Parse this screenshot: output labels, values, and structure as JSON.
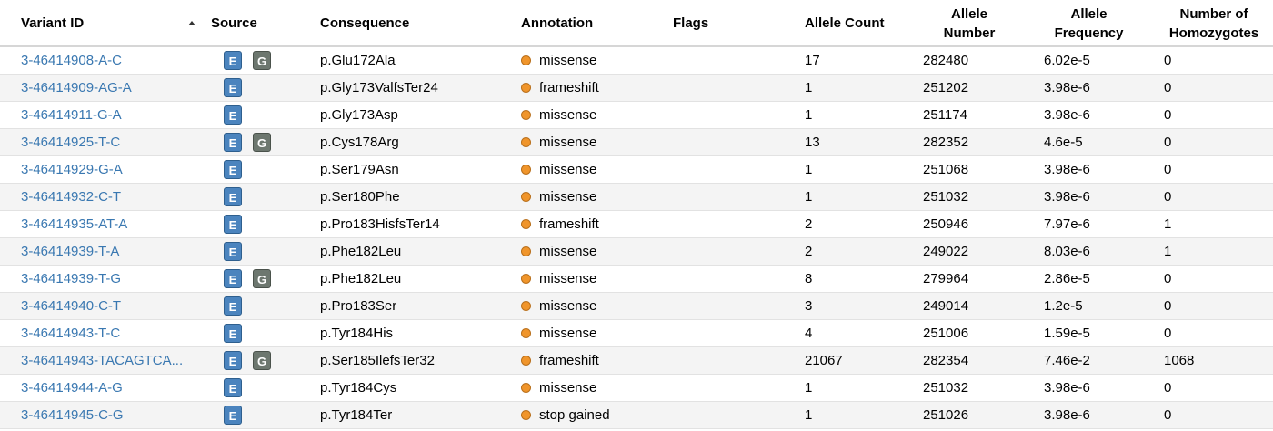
{
  "headers": {
    "variant_id": "Variant ID",
    "source": "Source",
    "consequence": "Consequence",
    "annotation": "Annotation",
    "flags": "Flags",
    "allele_count": "Allele Count",
    "allele_number_1": "Allele",
    "allele_number_2": "Number",
    "allele_frequency_1": "Allele",
    "allele_frequency_2": "Frequency",
    "homozygotes_1": "Number of",
    "homozygotes_2": "Homozygotes"
  },
  "badges": {
    "exome": "E",
    "genome": "G"
  },
  "colors": {
    "link": "#3a78b1",
    "exome_badge": "#4b84be",
    "genome_badge": "#6d776f",
    "annotation_dot": "#f0952b"
  },
  "rows": [
    {
      "variant_id": "3-46414908-A-C",
      "exome": true,
      "genome": true,
      "consequence": "p.Glu172Ala",
      "annotation": "missense",
      "allele_count": "17",
      "allele_number": "282480",
      "allele_frequency": "6.02e-5",
      "homozygotes": "0"
    },
    {
      "variant_id": "3-46414909-AG-A",
      "exome": true,
      "genome": false,
      "consequence": "p.Gly173ValfsTer24",
      "annotation": "frameshift",
      "allele_count": "1",
      "allele_number": "251202",
      "allele_frequency": "3.98e-6",
      "homozygotes": "0"
    },
    {
      "variant_id": "3-46414911-G-A",
      "exome": true,
      "genome": false,
      "consequence": "p.Gly173Asp",
      "annotation": "missense",
      "allele_count": "1",
      "allele_number": "251174",
      "allele_frequency": "3.98e-6",
      "homozygotes": "0"
    },
    {
      "variant_id": "3-46414925-T-C",
      "exome": true,
      "genome": true,
      "consequence": "p.Cys178Arg",
      "annotation": "missense",
      "allele_count": "13",
      "allele_number": "282352",
      "allele_frequency": "4.6e-5",
      "homozygotes": "0"
    },
    {
      "variant_id": "3-46414929-G-A",
      "exome": true,
      "genome": false,
      "consequence": "p.Ser179Asn",
      "annotation": "missense",
      "allele_count": "1",
      "allele_number": "251068",
      "allele_frequency": "3.98e-6",
      "homozygotes": "0"
    },
    {
      "variant_id": "3-46414932-C-T",
      "exome": true,
      "genome": false,
      "consequence": "p.Ser180Phe",
      "annotation": "missense",
      "allele_count": "1",
      "allele_number": "251032",
      "allele_frequency": "3.98e-6",
      "homozygotes": "0"
    },
    {
      "variant_id": "3-46414935-AT-A",
      "exome": true,
      "genome": false,
      "consequence": "p.Pro183HisfsTer14",
      "annotation": "frameshift",
      "allele_count": "2",
      "allele_number": "250946",
      "allele_frequency": "7.97e-6",
      "homozygotes": "1"
    },
    {
      "variant_id": "3-46414939-T-A",
      "exome": true,
      "genome": false,
      "consequence": "p.Phe182Leu",
      "annotation": "missense",
      "allele_count": "2",
      "allele_number": "249022",
      "allele_frequency": "8.03e-6",
      "homozygotes": "1"
    },
    {
      "variant_id": "3-46414939-T-G",
      "exome": true,
      "genome": true,
      "consequence": "p.Phe182Leu",
      "annotation": "missense",
      "allele_count": "8",
      "allele_number": "279964",
      "allele_frequency": "2.86e-5",
      "homozygotes": "0"
    },
    {
      "variant_id": "3-46414940-C-T",
      "exome": true,
      "genome": false,
      "consequence": "p.Pro183Ser",
      "annotation": "missense",
      "allele_count": "3",
      "allele_number": "249014",
      "allele_frequency": "1.2e-5",
      "homozygotes": "0"
    },
    {
      "variant_id": "3-46414943-T-C",
      "exome": true,
      "genome": false,
      "consequence": "p.Tyr184His",
      "annotation": "missense",
      "allele_count": "4",
      "allele_number": "251006",
      "allele_frequency": "1.59e-5",
      "homozygotes": "0"
    },
    {
      "variant_id": "3-46414943-TACAGTCA...",
      "exome": true,
      "genome": true,
      "consequence": "p.Ser185IlefsTer32",
      "annotation": "frameshift",
      "allele_count": "21067",
      "allele_number": "282354",
      "allele_frequency": "7.46e-2",
      "homozygotes": "1068"
    },
    {
      "variant_id": "3-46414944-A-G",
      "exome": true,
      "genome": false,
      "consequence": "p.Tyr184Cys",
      "annotation": "missense",
      "allele_count": "1",
      "allele_number": "251032",
      "allele_frequency": "3.98e-6",
      "homozygotes": "0"
    },
    {
      "variant_id": "3-46414945-C-G",
      "exome": true,
      "genome": false,
      "consequence": "p.Tyr184Ter",
      "annotation": "stop gained",
      "allele_count": "1",
      "allele_number": "251026",
      "allele_frequency": "3.98e-6",
      "homozygotes": "0"
    }
  ]
}
